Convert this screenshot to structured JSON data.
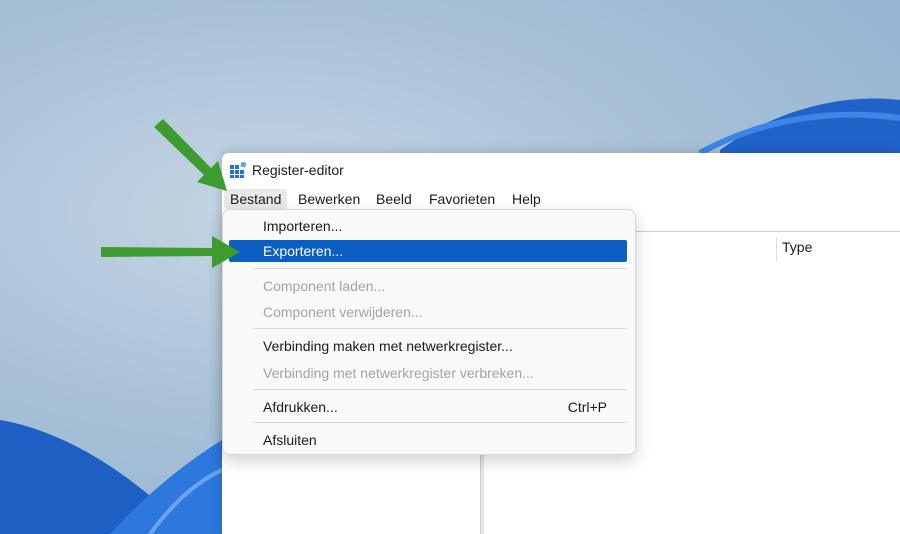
{
  "window": {
    "title": "Register-editor"
  },
  "menubar": {
    "items": [
      {
        "label": "Bestand",
        "name": "menu-bestand"
      },
      {
        "label": "Bewerken",
        "name": "menu-bewerken"
      },
      {
        "label": "Beeld",
        "name": "menu-beeld"
      },
      {
        "label": "Favorieten",
        "name": "menu-favorieten"
      },
      {
        "label": "Help",
        "name": "menu-help"
      }
    ]
  },
  "list": {
    "column_type": "Type"
  },
  "file_menu": {
    "items": [
      {
        "label": "Importeren...",
        "state": "enabled"
      },
      {
        "label": "Exporteren...",
        "state": "selected"
      },
      {
        "label": "Component laden...",
        "state": "disabled"
      },
      {
        "label": "Component verwijderen...",
        "state": "disabled"
      },
      {
        "label": "Verbinding maken met netwerkregister...",
        "state": "enabled"
      },
      {
        "label": "Verbinding met netwerkregister verbreken...",
        "state": "disabled"
      },
      {
        "label": "Afdrukken...",
        "shortcut": "Ctrl+P",
        "state": "enabled"
      },
      {
        "label": "Afsluiten",
        "state": "enabled"
      }
    ]
  },
  "colors": {
    "selected_bg": "#0b5ec2",
    "annotation_arrow": "#3e9b2f",
    "disabled_text": "#a3a3a3"
  },
  "icons": {
    "app": "registry-editor-icon"
  }
}
